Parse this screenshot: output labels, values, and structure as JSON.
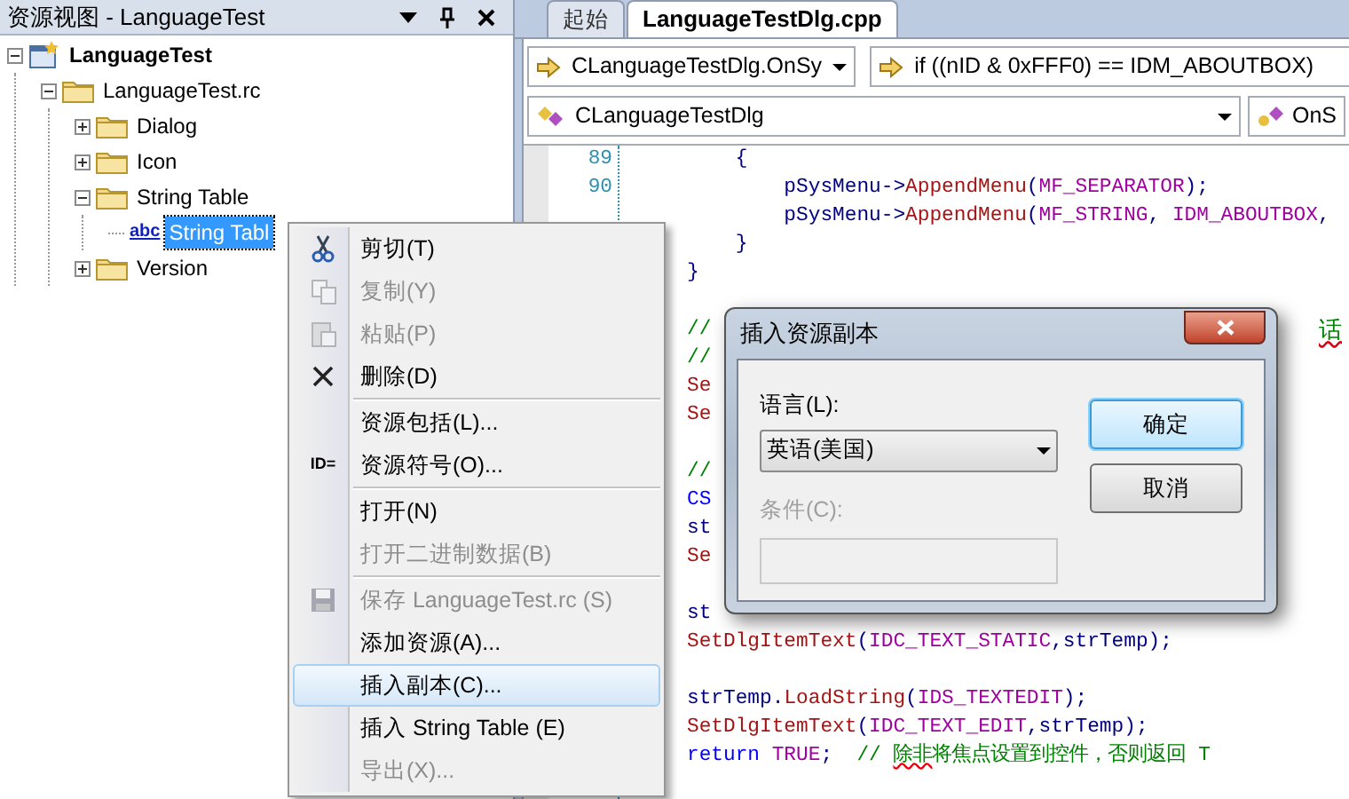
{
  "resource_view": {
    "title": "资源视图 - LanguageTest",
    "tree": [
      {
        "label": "LanguageTest",
        "kind": "project",
        "expanded": true,
        "selected": false,
        "children": [
          {
            "label": "LanguageTest.rc",
            "kind": "folder",
            "expanded": true,
            "selected": false,
            "children": [
              {
                "label": "Dialog",
                "kind": "folder",
                "expanded": false,
                "selected": false
              },
              {
                "label": "Icon",
                "kind": "folder",
                "expanded": false,
                "selected": false
              },
              {
                "label": "String Table",
                "kind": "folder",
                "expanded": true,
                "selected": false,
                "children": [
                  {
                    "label": "String Tabl",
                    "kind": "string",
                    "icon_text": "abc",
                    "selected": true
                  }
                ]
              },
              {
                "label": "Version",
                "kind": "folder",
                "expanded": false,
                "selected": false
              }
            ]
          }
        ]
      }
    ]
  },
  "editor": {
    "tabs": [
      {
        "label": "起始",
        "selected": false
      },
      {
        "label": "LanguageTestDlg.cpp",
        "selected": true
      }
    ],
    "scope_combo": "CLanguageTestDlg.OnSy",
    "statement_combo": "if ((nID & 0xFFF0) == IDM_ABOUTBOX)",
    "class_combo": "CLanguageTestDlg",
    "member_combo": "OnS",
    "blocks": [
      {
        "lines": [
          {
            "number": "89",
            "segments": [
              {
                "text": "    {",
                "kind": "plain"
              }
            ]
          },
          {
            "number": "90",
            "segments": [
              {
                "text": "        pSysMenu->",
                "kind": "plain"
              },
              {
                "text": "AppendMenu",
                "kind": "func"
              },
              {
                "text": "(",
                "kind": "plain"
              },
              {
                "text": "MF_SEPARATOR",
                "kind": "macro"
              },
              {
                "text": ");",
                "kind": "plain"
              }
            ]
          },
          {
            "segments": [
              {
                "text": "        pSysMenu->",
                "kind": "plain"
              },
              {
                "text": "AppendMenu",
                "kind": "func"
              },
              {
                "text": "(",
                "kind": "plain"
              },
              {
                "text": "MF_STRING",
                "kind": "macro"
              },
              {
                "text": ", ",
                "kind": "plain"
              },
              {
                "text": "IDM_ABOUTBOX",
                "kind": "macro"
              },
              {
                "text": ",",
                "kind": "plain"
              }
            ]
          },
          {
            "segments": [
              {
                "text": "    }",
                "kind": "plain"
              }
            ]
          },
          {
            "segments": [
              {
                "text": "}",
                "kind": "plain"
              }
            ]
          }
        ]
      },
      {
        "lines": [
          {
            "segments": [
              {
                "text": "//",
                "kind": "comment"
              }
            ],
            "tail": {
              "text": "话",
              "kind": "comment",
              "spell_error": true
            }
          },
          {
            "segments": [
              {
                "text": "//",
                "kind": "comment"
              }
            ]
          },
          {
            "segments": [
              {
                "text": "Se",
                "kind": "func"
              }
            ]
          },
          {
            "segments": [
              {
                "text": "Se",
                "kind": "func"
              }
            ]
          }
        ]
      },
      {
        "lines": [
          {
            "segments": [
              {
                "text": "//",
                "kind": "comment"
              }
            ]
          },
          {
            "segments": [
              {
                "text": "CS",
                "kind": "keyword"
              }
            ]
          },
          {
            "segments": [
              {
                "text": "st",
                "kind": "plain"
              }
            ]
          },
          {
            "segments": [
              {
                "text": "Se",
                "kind": "func"
              }
            ]
          }
        ]
      },
      {
        "lines": [
          {
            "segments": [
              {
                "text": "st",
                "kind": "plain"
              }
            ]
          },
          {
            "segments": [
              {
                "text": "SetDlgItemText",
                "kind": "func"
              },
              {
                "text": "(",
                "kind": "plain"
              },
              {
                "text": "IDC_TEXT_STATIC",
                "kind": "macro"
              },
              {
                "text": ",strTemp);",
                "kind": "plain"
              }
            ]
          }
        ]
      },
      {
        "lines": [
          {
            "segments": [
              {
                "text": "strTemp.",
                "kind": "plain"
              },
              {
                "text": "LoadString",
                "kind": "func"
              },
              {
                "text": "(",
                "kind": "plain"
              },
              {
                "text": "IDS_TEXTEDIT",
                "kind": "macro"
              },
              {
                "text": ");",
                "kind": "plain"
              }
            ]
          },
          {
            "segments": [
              {
                "text": "SetDlgItemText",
                "kind": "func"
              },
              {
                "text": "(",
                "kind": "plain"
              },
              {
                "text": "IDC_TEXT_EDIT",
                "kind": "macro"
              },
              {
                "text": ",strTemp);",
                "kind": "plain"
              }
            ]
          },
          {
            "segments": [
              {
                "text": "return",
                "kind": "keyword"
              },
              {
                "text": " TRUE",
                "kind": "macro"
              },
              {
                "text": ";  ",
                "kind": "plain"
              },
              {
                "text": "// ",
                "kind": "comment"
              },
              {
                "text": "除非",
                "kind": "comment",
                "spell_error": true
              },
              {
                "text": "将焦点设置到控件，否则返回 T",
                "kind": "comment"
              }
            ]
          }
        ]
      }
    ]
  },
  "context_menu": [
    {
      "kind": "cut",
      "label": "剪切(T)",
      "disabled": false,
      "selected": false
    },
    {
      "kind": "copy",
      "label": "复制(Y)",
      "disabled": true,
      "selected": false
    },
    {
      "kind": "paste",
      "label": "粘贴(P)",
      "disabled": true,
      "selected": false
    },
    {
      "kind": "delete",
      "label": "删除(D)",
      "disabled": false,
      "selected": false
    },
    {
      "kind": "separator"
    },
    {
      "kind": "item",
      "label": "资源包括(L)...",
      "disabled": false,
      "selected": false
    },
    {
      "kind": "item",
      "label": "资源符号(O)...",
      "icon_text": "ID=",
      "disabled": false,
      "selected": false
    },
    {
      "kind": "separator"
    },
    {
      "kind": "item",
      "label": "打开(N)",
      "disabled": false,
      "selected": false
    },
    {
      "kind": "item",
      "label": "打开二进制数据(B)",
      "disabled": true,
      "selected": false
    },
    {
      "kind": "separator"
    },
    {
      "kind": "save",
      "label": "保存 LanguageTest.rc (S)",
      "disabled": true,
      "selected": false
    },
    {
      "kind": "item",
      "label": "添加资源(A)...",
      "disabled": false,
      "selected": false
    },
    {
      "kind": "item",
      "label": "插入副本(C)...",
      "disabled": false,
      "selected": true
    },
    {
      "kind": "item",
      "label": "插入 String Table (E)",
      "disabled": false,
      "selected": false
    },
    {
      "kind": "item",
      "label": "导出(X)...",
      "disabled": true,
      "selected": false
    }
  ],
  "dialog": {
    "title": "插入资源副本",
    "language_label": "语言(L):",
    "language_value": "英语(美国)",
    "condition_label": "条件(C):",
    "condition_disabled": true,
    "buttons": [
      {
        "label": "确定",
        "default": true
      },
      {
        "label": "取消",
        "default": false
      }
    ]
  }
}
